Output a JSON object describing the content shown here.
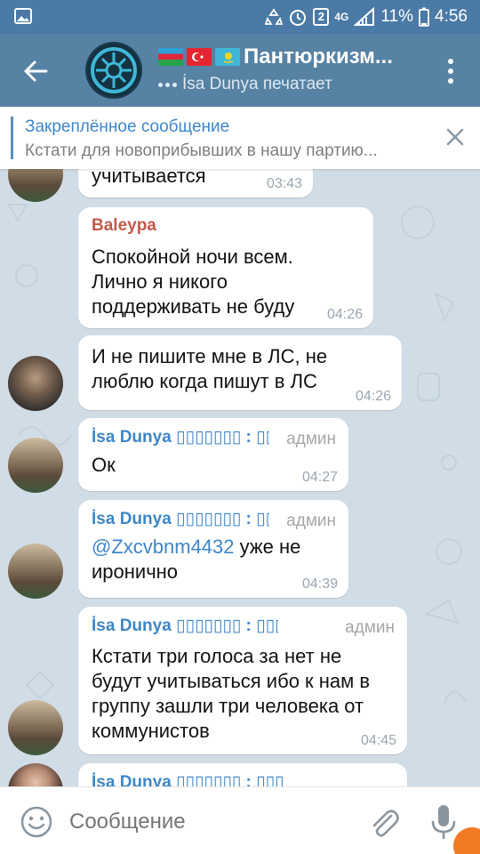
{
  "status_bar": {
    "badge": "2",
    "network": "4G",
    "battery": "11%",
    "time": "4:56"
  },
  "header": {
    "flags": [
      "Azerbaijan",
      "Turkey",
      "Kazakhstan"
    ],
    "title": "Пантюркизм...",
    "status": "İsa Dunya печатает"
  },
  "pinned": {
    "label": "Закреплённое сообщение",
    "text": "Кстати для новоприбывших в нашу партию..."
  },
  "messages": [
    {
      "text": "учитывается",
      "time": "03:43"
    },
    {
      "sender": "Baleypa",
      "text": "Спокойной ночи всем. Лично я никого поддерживать не буду",
      "time": "04:26"
    },
    {
      "text": "И не пишите мне в ЛС, не люблю когда пишут в ЛС",
      "time": "04:26"
    },
    {
      "sender": "İsa Dunya ▯▯▯▯▯▯▯ : ▯▯▯",
      "role": "админ",
      "text": "Ок",
      "time": "04:27"
    },
    {
      "sender": "İsa Dunya ▯▯▯▯▯▯▯ : ▯▯▯",
      "role": "админ",
      "mention": "@Zxcvbnm4432",
      "text": " уже не иронично",
      "time": "04:39"
    },
    {
      "sender": "İsa Dunya ▯▯▯▯▯▯▯ : ▯▯▯",
      "role": "админ",
      "text": "Кстати три голоса за нет не будут учитываться ибо к нам в группу зашли три человека от коммунистов",
      "time": "04:45"
    },
    {
      "sender": "İsa Dunya ▯▯▯▯▯▯▯ : ▯▯▯"
    }
  ],
  "input": {
    "placeholder": "Сообщение"
  },
  "colors": {
    "header": "#5682a3",
    "status_bar": "#4a7aa5",
    "accent": "#3e86c6",
    "sender_red": "#c25a4c"
  }
}
